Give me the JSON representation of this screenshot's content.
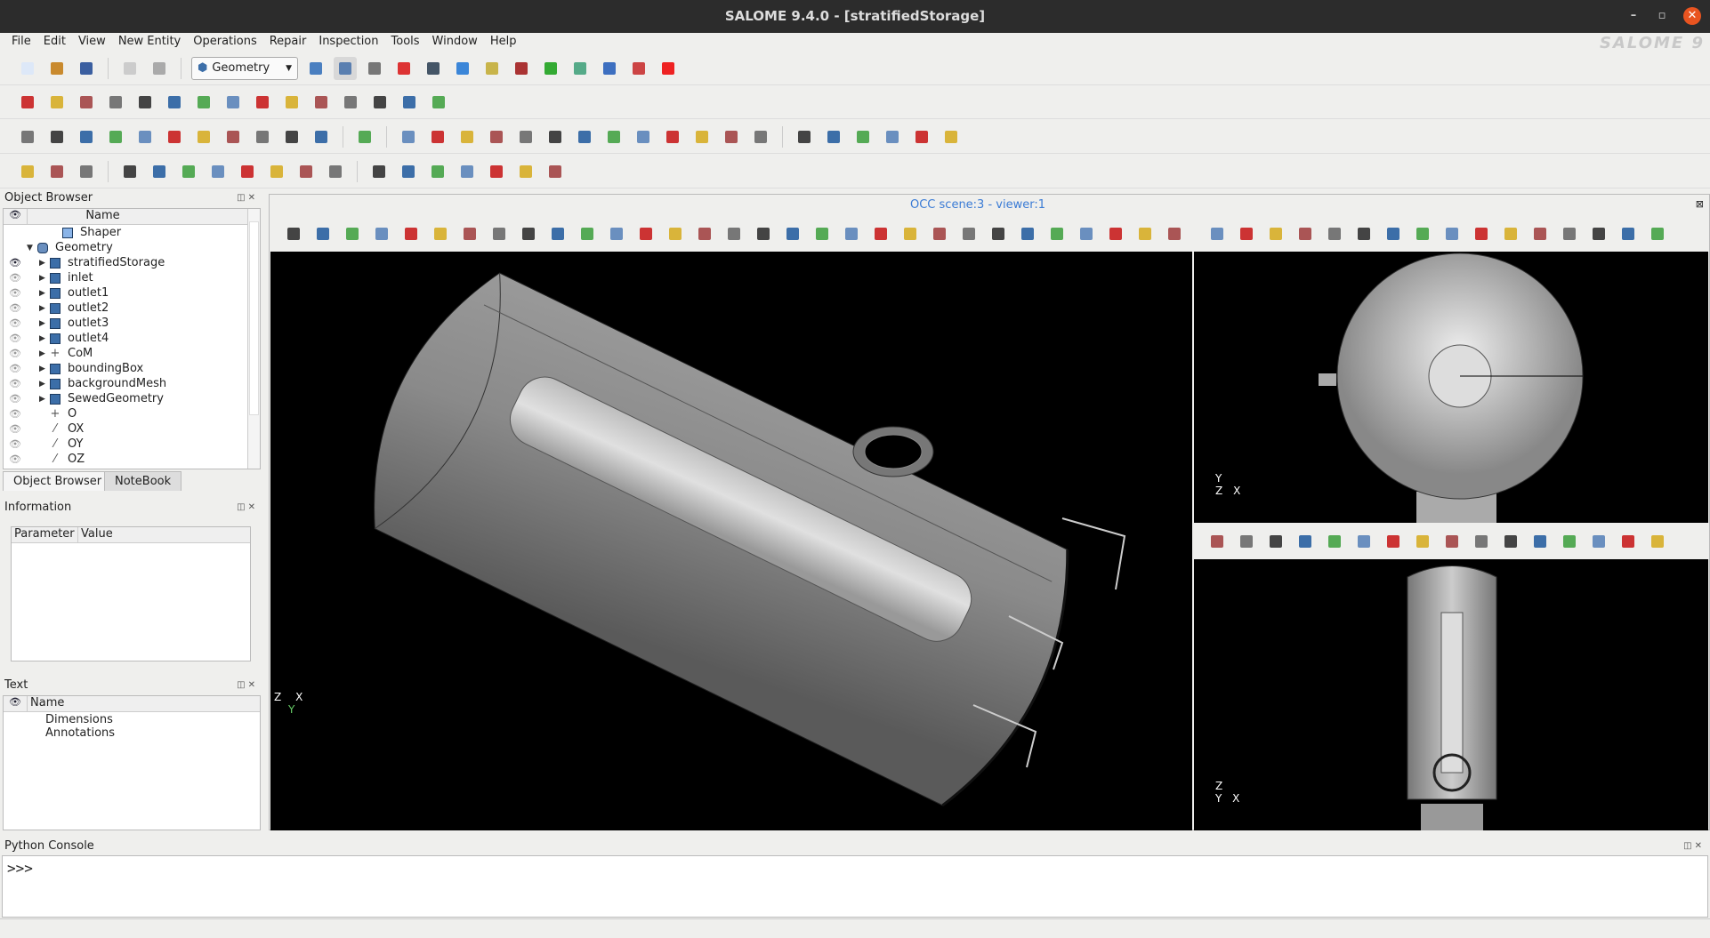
{
  "window": {
    "title": "SALOME  9.4.0 - [stratifiedStorage]",
    "brand": "SALOME 9"
  },
  "menu": [
    "File",
    "Edit",
    "View",
    "New Entity",
    "Operations",
    "Repair",
    "Inspection",
    "Tools",
    "Window",
    "Help"
  ],
  "toolbar": {
    "module": "Geometry"
  },
  "object_browser": {
    "title": "Object Browser",
    "column": "Name",
    "items": [
      {
        "label": "Shaper",
        "indent": 1,
        "icon": "shaper-icon",
        "eye": "none",
        "arrow": ""
      },
      {
        "label": "Geometry",
        "indent": 0,
        "icon": "geometry-icon",
        "eye": "none",
        "arrow": "down"
      },
      {
        "label": "stratifiedStorage",
        "indent": 2,
        "icon": "solid-icon",
        "eye": "on",
        "arrow": "right"
      },
      {
        "label": "inlet",
        "indent": 2,
        "icon": "face-icon",
        "eye": "off",
        "arrow": "right"
      },
      {
        "label": "outlet1",
        "indent": 2,
        "icon": "face-icon",
        "eye": "off",
        "arrow": "right"
      },
      {
        "label": "outlet2",
        "indent": 2,
        "icon": "face-icon",
        "eye": "off",
        "arrow": "right"
      },
      {
        "label": "outlet3",
        "indent": 2,
        "icon": "face-icon",
        "eye": "off",
        "arrow": "right"
      },
      {
        "label": "outlet4",
        "indent": 2,
        "icon": "face-icon",
        "eye": "off",
        "arrow": "right"
      },
      {
        "label": "CoM",
        "indent": 2,
        "icon": "point-icon",
        "eye": "off",
        "arrow": "right"
      },
      {
        "label": "boundingBox",
        "indent": 2,
        "icon": "solid-icon",
        "eye": "off",
        "arrow": "right"
      },
      {
        "label": "backgroundMesh",
        "indent": 2,
        "icon": "solid-icon",
        "eye": "off",
        "arrow": "right"
      },
      {
        "label": "SewedGeometry",
        "indent": 2,
        "icon": "shell-icon",
        "eye": "off",
        "arrow": "right"
      },
      {
        "label": "O",
        "indent": 2,
        "icon": "point-icon",
        "eye": "off",
        "arrow": ""
      },
      {
        "label": "OX",
        "indent": 2,
        "icon": "line-icon",
        "eye": "off",
        "arrow": ""
      },
      {
        "label": "OY",
        "indent": 2,
        "icon": "line-icon",
        "eye": "off",
        "arrow": ""
      },
      {
        "label": "OZ",
        "indent": 2,
        "icon": "line-icon",
        "eye": "off",
        "arrow": ""
      }
    ],
    "tabs": [
      "Object Browser",
      "NoteBook"
    ]
  },
  "information": {
    "title": "Information",
    "columns": [
      "Parameter",
      "Value"
    ]
  },
  "text_panel": {
    "title": "Text",
    "column": "Name",
    "items": [
      "Dimensions",
      "Annotations"
    ]
  },
  "viewer": {
    "title": "OCC scene:3 - viewer:1",
    "main_axes": {
      "a": "Z",
      "b": "X",
      "c": "Y"
    },
    "top_axes": {
      "a": "Y",
      "b": "Z",
      "c": "X"
    },
    "bottom_axes": {
      "a": "Z",
      "b": "Y",
      "c": "X"
    }
  },
  "console": {
    "title": "Python Console",
    "prompt": ">>>"
  },
  "colors": {
    "accent": "#3a7bd5",
    "titlebar": "#2c2c2c",
    "close": "#e95420"
  }
}
